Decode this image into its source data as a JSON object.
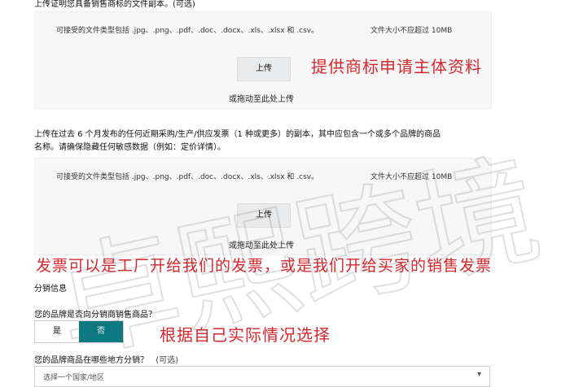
{
  "section1": {
    "heading": "上传证明您具备销售商标的文件副本。(可选)",
    "file_types": "可接受的文件类型包括 .jpg、.png、.pdf、.doc、.docx、.xls、.xlsx 和 .csv。",
    "size_limit": "文件大小不应超过 10MB",
    "upload_label": "上传",
    "drag_label": "或拖动至此处上传"
  },
  "section2": {
    "heading_line1": "上传在过去 6 个月发布的任何近期采购/生产/供应发票（1 种或更多）的副本，其中应包含一个或多个品牌的商品",
    "heading_line2": "名称。请确保隐藏任何敏感数据（例如：定价详情）。",
    "file_types": "可接受的文件类型包括 .jpg、.png、.pdf、.doc、.docx、.xls、.xlsx 和 .csv。",
    "size_limit": "文件大小不应超过 10MB",
    "upload_label": "上传",
    "drag_label": "或拖动至此处上传"
  },
  "distribution": {
    "title": "分销信息",
    "question": "您的品牌是否向分销商销售商品？",
    "yes": "是",
    "no": "否",
    "region_question": "您的品牌商品在哪些地方分销？",
    "optional": "(可选)",
    "select_placeholder": "选择一个国家/地区"
  },
  "annotations": {
    "note1": "提供商标申请主体资料",
    "note2": "发票可以是工厂开给我们的发票，或是我们开给买家的销售发票",
    "note3": "根据自己实际情况选择"
  },
  "watermark": "卓熙跨境",
  "colors": {
    "accent": "#0b7a83",
    "annotation": "#d7272d"
  }
}
